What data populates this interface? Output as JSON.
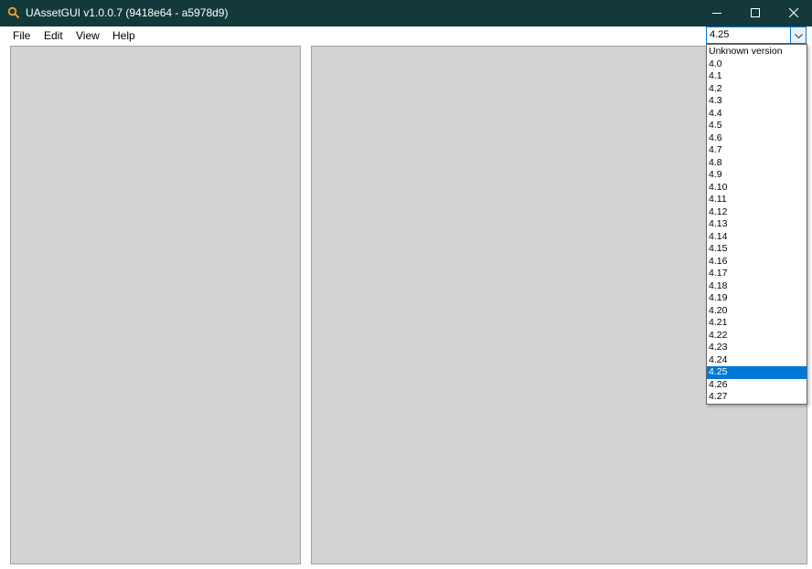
{
  "window": {
    "title": "UAssetGUI v1.0.0.7 (9418e64 - a5978d9)",
    "titlebar_color": "#14393a"
  },
  "menubar": {
    "items": [
      "File",
      "Edit",
      "View",
      "Help"
    ]
  },
  "version_combo": {
    "selected": "4.25",
    "accent_color": "#0078d7",
    "options": [
      "Unknown version",
      "4.0",
      "4.1",
      "4.2",
      "4.3",
      "4.4",
      "4.5",
      "4.6",
      "4.7",
      "4.8",
      "4.9",
      "4.10",
      "4.11",
      "4.12",
      "4.13",
      "4.14",
      "4.15",
      "4.16",
      "4.17",
      "4.18",
      "4.19",
      "4.20",
      "4.21",
      "4.22",
      "4.23",
      "4.24",
      "4.25",
      "4.26",
      "4.27"
    ],
    "highlighted": "4.25"
  },
  "icons": {
    "app": "magnifier-icon",
    "minimize": "minimize-icon",
    "maximize": "maximize-icon",
    "close": "close-icon",
    "dropdown": "chevron-down-icon"
  }
}
